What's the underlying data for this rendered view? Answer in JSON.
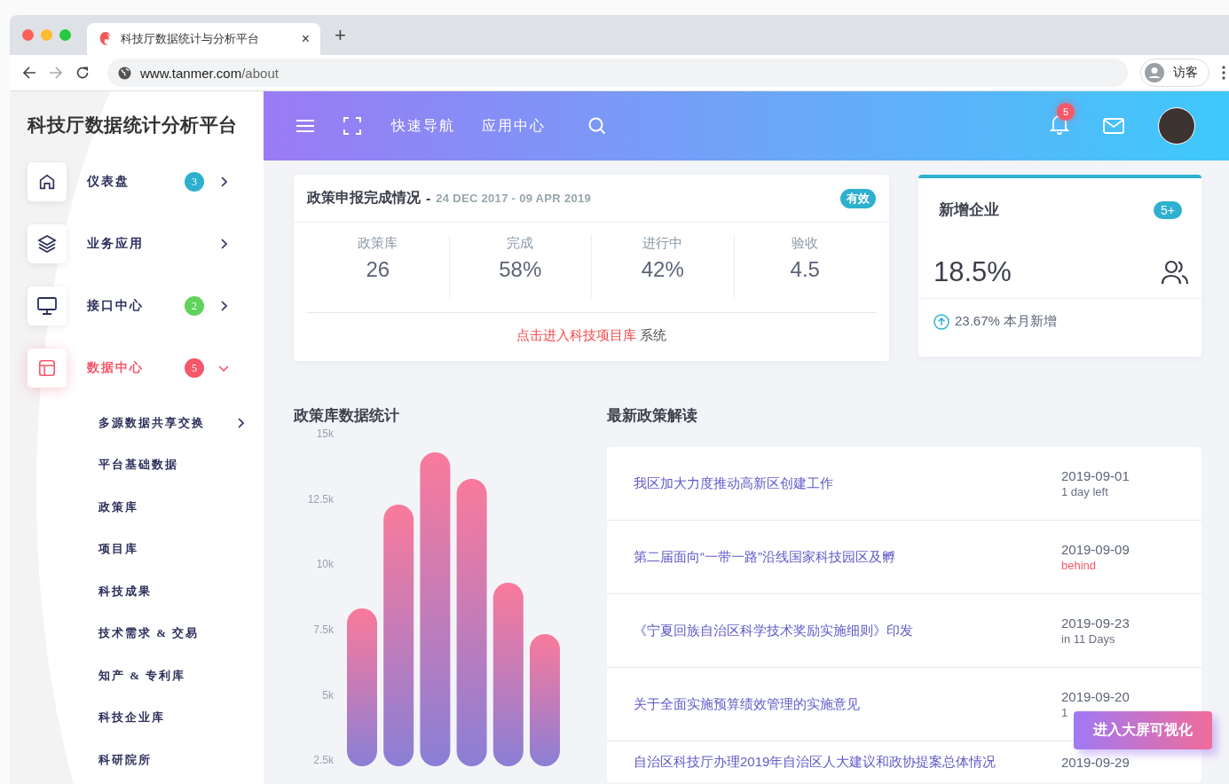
{
  "browser": {
    "tab": {
      "title": "科技厅数据统计与分析平台",
      "close": "×"
    },
    "new_tab": "+",
    "url": {
      "host": "www.tanmer.com",
      "path": "/about"
    },
    "profile": "访客"
  },
  "sidebar": {
    "title": "科技厅数据统计分析平台",
    "items": [
      {
        "label": "仪表盘",
        "badge": {
          "text": "3",
          "color": "#2eb0d0"
        },
        "selected": false,
        "expanded": false
      },
      {
        "label": "业务应用",
        "selected": false,
        "expanded": false
      },
      {
        "label": "接口中心",
        "badge": {
          "text": "2",
          "color": "#5fd35b"
        },
        "selected": false,
        "expanded": false
      },
      {
        "label": "数据中心",
        "badge": {
          "text": "5",
          "color": "#f5586a"
        },
        "selected": true,
        "expanded": true,
        "children": [
          {
            "label": "多源数据共享交换",
            "submenu": true
          },
          {
            "label": "平台基础数据",
            "submenu": false
          },
          {
            "label": "政策库",
            "submenu": false
          },
          {
            "label": "项目库",
            "submenu": false
          },
          {
            "label": "科技成果",
            "submenu": false
          },
          {
            "label": "技术需求 & 交易",
            "submenu": false
          },
          {
            "label": "知产 & 专利库",
            "submenu": false
          },
          {
            "label": "科技企业库",
            "submenu": false
          },
          {
            "label": "科研院所",
            "submenu": false
          }
        ]
      }
    ]
  },
  "header": {
    "links": [
      "快速导航",
      "应用中心"
    ],
    "notifications": "5"
  },
  "summary_card": {
    "title": "政策申报完成情况",
    "separator": "-",
    "date_range": "24 DEC 2017 - 09 APR 2019",
    "badge": "有效",
    "stats": [
      {
        "label": "政策库",
        "value": "26"
      },
      {
        "label": "完成",
        "value": "58%"
      },
      {
        "label": "进行中",
        "value": "42%"
      },
      {
        "label": "验收",
        "value": "4.5"
      }
    ],
    "footer_link": "点击进入科技项目库",
    "footer_text": "系统"
  },
  "kpi_card": {
    "title": "新增企业",
    "badge": "5+",
    "value": "18.5%",
    "footer": "23.67% 本月新增"
  },
  "chart_section": {
    "title": "政策库数据统计",
    "axis_labels": [
      "15k",
      "12.5k",
      "10k",
      "7.5k",
      "5k",
      "2.5k"
    ]
  },
  "news": {
    "title": "最新政策解读",
    "rows": [
      {
        "title": "我区加大力度推动高新区创建工作",
        "date": "2019-09-01",
        "status": "1 day left",
        "color": "#6b6f80"
      },
      {
        "title": "第二届面向“一带一路”沿线国家科技园区及孵",
        "date": "2019-09-09",
        "status": "behind",
        "color": "#f5586a"
      },
      {
        "title": "《宁夏回族自治区科学技术奖励实施细则》印发",
        "date": "2019-09-23",
        "status": "in 11 Days",
        "color": "#6b6f80"
      },
      {
        "title": "关于全面实施预算绩效管理的实施意见",
        "date": "2019-09-20",
        "status": "1",
        "color": "#6b6f80"
      },
      {
        "title": "自治区科技厅办理2019年自治区人大建议和政协提案总体情况",
        "date": "2019-09-29"
      }
    ]
  },
  "float_button": "进入大屏可视化"
}
